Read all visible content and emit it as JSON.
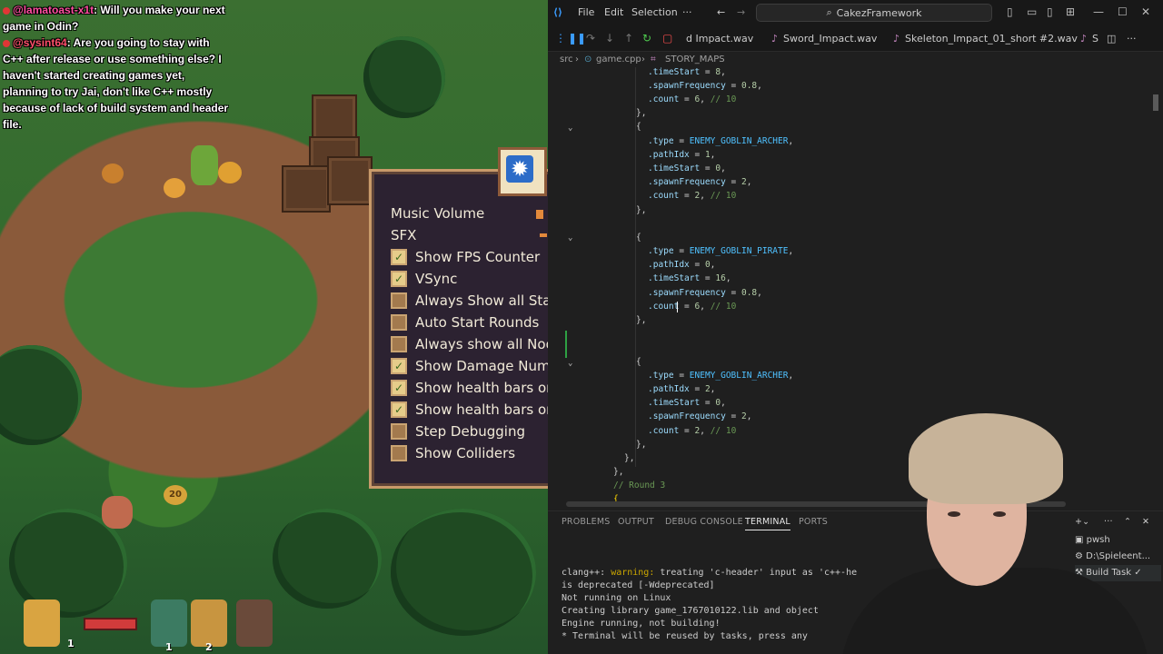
{
  "chat": [
    {
      "user": "@lamatoast-x1t",
      "text": ": Will you make your next game in Odin?"
    },
    {
      "user": "@sysint64",
      "text": ": Are you going to stay with C++ after release or use something else? I haven't started creating games yet, planning to try Jai, don't like C++ mostly because of lack of build system and header file."
    }
  ],
  "game": {
    "options": [
      {
        "label": "Music Volume",
        "type": "slider"
      },
      {
        "label": "SFX",
        "type": "slider"
      },
      {
        "label": "Show FPS Counter",
        "checked": true
      },
      {
        "label": "VSync",
        "checked": true
      },
      {
        "label": "Always Show all Stats",
        "checked": false
      },
      {
        "label": "Auto Start Rounds",
        "checked": false
      },
      {
        "label": "Always show all Nodes",
        "checked": false
      },
      {
        "label": "Show Damage Numbers",
        "checked": true
      },
      {
        "label": "Show health bars on",
        "checked": true
      },
      {
        "label": "Show health bars on",
        "checked": true
      },
      {
        "label": "Step Debugging",
        "checked": false
      },
      {
        "label": "Show Colliders",
        "checked": false
      }
    ],
    "gear_icon": "gear-icon",
    "round_badge": "20",
    "hud_counts": [
      "1",
      "1",
      "2"
    ]
  },
  "vscode": {
    "menu": {
      "file": "File",
      "edit": "Edit",
      "selection": "Selection",
      "more": "···"
    },
    "command_center": "CakezFramework",
    "tabs": [
      {
        "label": "d Impact.wav"
      },
      {
        "label": "Sword_Impact.wav"
      },
      {
        "label": "Skeleton_Impact_01_short #2.wav"
      },
      {
        "label": "S"
      }
    ],
    "breadcrumb": {
      "folder": "src",
      "file": "game.cpp",
      "symbol": "STORY_MAPS"
    },
    "code": [
      {
        "t": ".timeStart = 8,"
      },
      {
        "t": ".spawnFrequency = 0.8,"
      },
      {
        "t": ".count = 6, // 10"
      },
      {
        "t": "},"
      },
      {
        "t": "{"
      },
      {
        "t": ".type = ENEMY_GOBLIN_ARCHER,"
      },
      {
        "t": ".pathIdx = 1,"
      },
      {
        "t": ".timeStart = 0,"
      },
      {
        "t": ".spawnFrequency = 2,"
      },
      {
        "t": ".count = 2, // 10"
      },
      {
        "t": "},"
      },
      {
        "t": ""
      },
      {
        "t": "{"
      },
      {
        "t": ".type = ENEMY_GOBLIN_PIRATE,"
      },
      {
        "t": ".pathIdx = 0,"
      },
      {
        "t": ".timeStart = 16,"
      },
      {
        "t": ".spawnFrequency = 0.8,"
      },
      {
        "t": ".count = 6, // 10"
      },
      {
        "t": "},"
      },
      {
        "t": ""
      },
      {
        "t": ""
      },
      {
        "t": "{"
      },
      {
        "t": ".type = ENEMY_GOBLIN_ARCHER,"
      },
      {
        "t": ".pathIdx = 2,"
      },
      {
        "t": ".timeStart = 0,"
      },
      {
        "t": ".spawnFrequency = 2,"
      },
      {
        "t": ".count = 2, // 10"
      },
      {
        "t": "},"
      },
      {
        "t": "},"
      },
      {
        "t": "},"
      },
      {
        "t": "// Round 3"
      },
      {
        "t": "{"
      }
    ],
    "panel_tabs": [
      "PROBLEMS",
      "OUTPUT",
      "DEBUG CONSOLE",
      "TERMINAL",
      "PORTS"
    ],
    "terminal_lines": [
      {
        "pre": "clang++: ",
        "warn": "warning:",
        "post": " treating 'c-header' input as 'c++-he"
      },
      {
        "pre": "is deprecated [-Wdeprecated]",
        "warn": "",
        "post": ""
      },
      {
        "pre": "Not running on Linux",
        "warn": "",
        "post": ""
      },
      {
        "pre": "   Creating library game_1767010122.lib and object",
        "warn": "",
        "post": ""
      },
      {
        "pre": "Engine running, not building!",
        "warn": "",
        "post": ""
      },
      {
        "pre": " *  Terminal will be reused by tasks, press any ",
        "warn": "",
        "post": ""
      }
    ],
    "terminal_list": [
      {
        "label": "pwsh"
      },
      {
        "label": "D:\\Spieleent..."
      },
      {
        "label": "Build  Task ✓"
      }
    ]
  }
}
